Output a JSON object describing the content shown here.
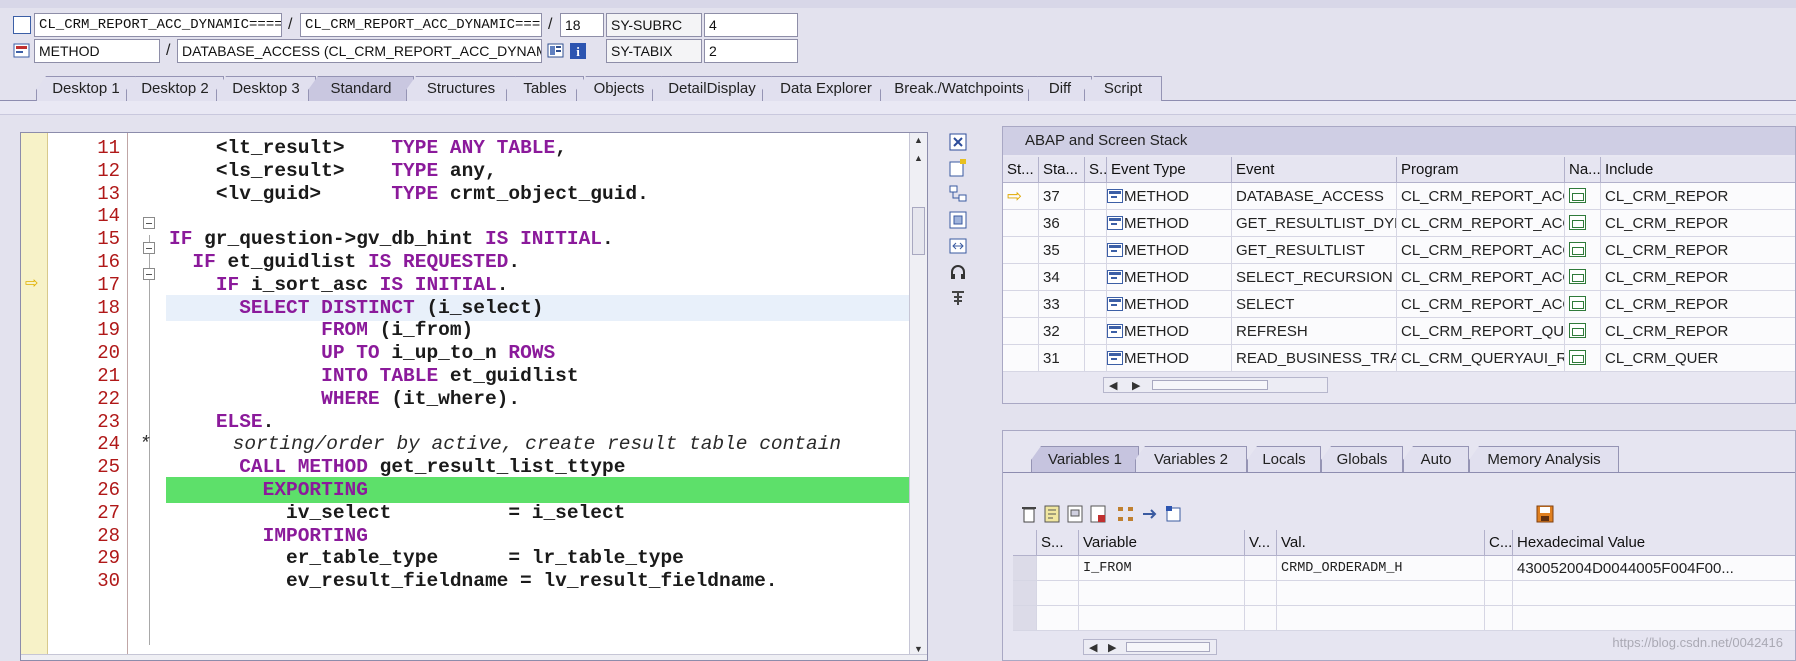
{
  "header": {
    "row1": {
      "program1": "CL_CRM_REPORT_ACC_DYNAMIC====...",
      "separator1": "/",
      "program2": "CL_CRM_REPORT_ACC_DYNAMIC====...",
      "separator2": "/",
      "line": "18",
      "sysvar": "SY-SUBRC",
      "sysval": "4"
    },
    "row2": {
      "event_type": "METHOD",
      "separator": "/",
      "event": "DATABASE_ACCESS (CL_CRM_REPORT_ACC_DYNAMIC)",
      "sysvar": "SY-TABIX",
      "sysval": "2"
    }
  },
  "tabs": [
    "Desktop 1",
    "Desktop 2",
    "Desktop 3",
    "Standard",
    "Structures",
    "Tables",
    "Objects",
    "DetailDisplay",
    "Data Explorer",
    "Break./Watchpoints",
    "Diff",
    "Script"
  ],
  "active_tab": "Standard",
  "editor": {
    "lines": [
      {
        "n": "11",
        "code": [
          "    ",
          "<lt_result>",
          "    ",
          "TYPE ANY TABLE",
          ","
        ]
      },
      {
        "n": "12",
        "code": [
          "    ",
          "<ls_result>",
          "    ",
          "TYPE",
          " any,"
        ]
      },
      {
        "n": "13",
        "code": [
          "    ",
          "<lv_guid>",
          "      ",
          "TYPE",
          " crmt_object_guid."
        ]
      },
      {
        "n": "14",
        "code": [
          ""
        ]
      },
      {
        "n": "15",
        "code": [
          "",
          "IF",
          " gr_question->gv_db_hint ",
          "IS INITIAL",
          "."
        ]
      },
      {
        "n": "16",
        "code": [
          "  ",
          "IF",
          " et_guidlist ",
          "IS REQUESTED",
          "."
        ]
      },
      {
        "n": "17",
        "code": [
          "    ",
          "IF",
          " i_sort_asc ",
          "IS INITIAL",
          "."
        ]
      },
      {
        "n": "18",
        "code": [
          "      ",
          "SELECT DISTINCT",
          " (i_select)"
        ]
      },
      {
        "n": "19",
        "code": [
          "             ",
          "FROM",
          " (i_from)"
        ]
      },
      {
        "n": "20",
        "code": [
          "             ",
          "UP TO",
          " i_up_to_n ",
          "ROWS"
        ]
      },
      {
        "n": "21",
        "code": [
          "             ",
          "INTO TABLE",
          " et_guidlist"
        ]
      },
      {
        "n": "22",
        "code": [
          "             ",
          "WHERE",
          " (it_where)."
        ]
      },
      {
        "n": "23",
        "code": [
          "    ",
          "ELSE",
          "."
        ]
      },
      {
        "n": "24",
        "comment": "*       sorting/order by active, create result table contain"
      },
      {
        "n": "25",
        "code": [
          "      ",
          "CALL METHOD",
          " get_result_list_ttype"
        ]
      },
      {
        "n": "26",
        "code": [
          "        ",
          "EXPORTING"
        ]
      },
      {
        "n": "27",
        "code": [
          "          iv_select          = i_select"
        ]
      },
      {
        "n": "28",
        "code": [
          "        ",
          "IMPORTING"
        ]
      },
      {
        "n": "29",
        "code": [
          "          er_table_type      = lr_table_type"
        ]
      },
      {
        "n": "30",
        "code": [
          "          ev_result_fieldname = lv_result_fieldname."
        ]
      }
    ]
  },
  "stack_panel": {
    "title": "ABAP and Screen Stack",
    "columns": [
      "St...",
      "Sta...",
      "S...",
      "Event Type",
      "Event",
      "Program",
      "Na...",
      "Include"
    ],
    "rows": [
      {
        "current": true,
        "level": "37",
        "type": "METHOD",
        "event": "DATABASE_ACCESS",
        "program": "CL_CRM_REPORT_ACC_...",
        "include": "CL_CRM_REPOR"
      },
      {
        "current": false,
        "level": "36",
        "type": "METHOD",
        "event": "GET_RESULTLIST_DYNA...",
        "program": "CL_CRM_REPORT_ACC_...",
        "include": "CL_CRM_REPOR"
      },
      {
        "current": false,
        "level": "35",
        "type": "METHOD",
        "event": "GET_RESULTLIST",
        "program": "CL_CRM_REPORT_ACC_...",
        "include": "CL_CRM_REPOR"
      },
      {
        "current": false,
        "level": "34",
        "type": "METHOD",
        "event": "SELECT_RECURSION",
        "program": "CL_CRM_REPORT_ACCR...",
        "include": "CL_CRM_REPOR"
      },
      {
        "current": false,
        "level": "33",
        "type": "METHOD",
        "event": "SELECT",
        "program": "CL_CRM_REPORT_ACCR...",
        "include": "CL_CRM_REPOR"
      },
      {
        "current": false,
        "level": "32",
        "type": "METHOD",
        "event": "REFRESH",
        "program": "CL_CRM_REPORT_QUES...",
        "include": "CL_CRM_REPOR"
      },
      {
        "current": false,
        "level": "31",
        "type": "METHOD",
        "event": "READ_BUSINESS_TRANS...",
        "program": "CL_CRM_QUERYAUI_RU...",
        "include": "CL_CRM_QUER"
      }
    ]
  },
  "variables_panel": {
    "tabs": [
      "Variables 1",
      "Variables 2",
      "Locals",
      "Globals",
      "Auto",
      "Memory Analysis"
    ],
    "active_tab": "Variables 1",
    "columns": [
      "S...",
      "Variable",
      "V...",
      "Val.",
      "C...",
      "Hexadecimal Value"
    ],
    "rows": [
      {
        "variable": "I_FROM",
        "value": "CRMD_ORDERADM_H",
        "hex": "430052004D0044005F004F00..."
      }
    ]
  },
  "watermark": "https://blog.csdn.net/0042416",
  "icons": {
    "stack_current": "yellow-arrow-icon",
    "row_type": "method-icon",
    "nav": "navigate-icon"
  }
}
